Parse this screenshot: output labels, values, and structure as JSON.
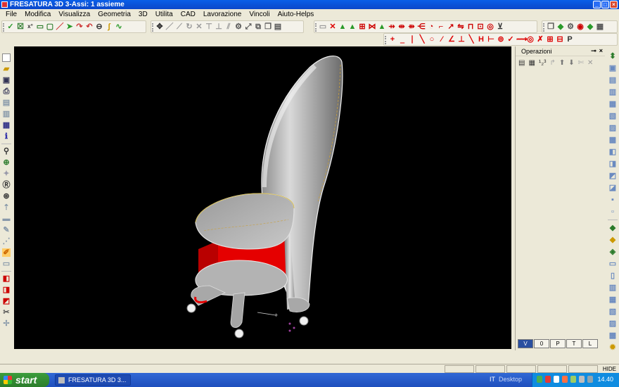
{
  "window": {
    "title": "FRESATURA 3D 3-Assi: 1 assieme"
  },
  "menu": {
    "items": [
      "File",
      "Modifica",
      "Visualizza",
      "Geometria",
      "3D",
      "Utilita",
      "CAD",
      "Lavorazione",
      "Vincoli",
      "Aiuto-Helps"
    ]
  },
  "panel": {
    "title": "Operazioni",
    "tabs": [
      "V",
      "0",
      "P",
      "T",
      "L"
    ]
  },
  "statusbar": {
    "hide_label": "HIDE"
  },
  "taskbar": {
    "start_label": "start",
    "task_label": "FRESATURA 3D 3...",
    "lang": "IT",
    "desktop_label": "Desktop",
    "clock": "14.40"
  },
  "colors": {
    "viewport_bg": "#000000",
    "model_surface": "#bdbdbd",
    "accent_red": "#e50000"
  }
}
